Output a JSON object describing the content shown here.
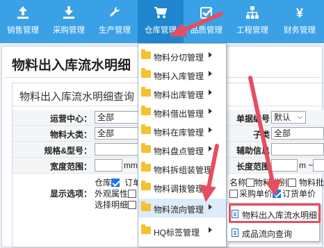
{
  "nav": [
    {
      "label": "销售管理",
      "icon": "upload-icon"
    },
    {
      "label": "采购管理",
      "icon": "download-icon"
    },
    {
      "label": "生产管理",
      "icon": "wrench-icon"
    },
    {
      "label": "仓库管理",
      "icon": "cart-icon"
    },
    {
      "label": "品质管理",
      "icon": "check-icon"
    },
    {
      "label": "工程管理",
      "icon": "sitemap-icon"
    },
    {
      "label": "财务管理",
      "icon": "yen-icon"
    }
  ],
  "page": {
    "title": "物料出入库流水明细"
  },
  "query": {
    "title": "物料出入库流水明细查询",
    "rows": {
      "center_label": "运营中心：",
      "center_value": "全部",
      "category_label": "物料大类：",
      "category_value": "全部",
      "spec_label": "规格&型号：",
      "width_label": "宽度范围：",
      "width_unit": "mm",
      "display_label": "显示选项：",
      "doc_label": "单据编号：",
      "doc_value": "默认",
      "subclass_label": "子类：",
      "subclass_value": "全部",
      "aux_label": "辅助信息：",
      "length_label": "长度范围：",
      "length_unit": "m ~"
    },
    "options": {
      "warehouse": "仓库",
      "order": "订单",
      "appearance": "外观属性",
      "detail": "选择明细",
      "name": "名称",
      "category": "物料类别",
      "batch": "物料批号",
      "purchase_price": "采购单价",
      "order_price": "订货单价"
    }
  },
  "menu": {
    "items": [
      {
        "label": "物料分切管理",
        "arrow": true
      },
      {
        "label": "物料入库管理",
        "arrow": true
      },
      {
        "label": "物料出库管理",
        "arrow": true
      },
      {
        "label": "物料借出管理",
        "arrow": true
      },
      {
        "label": "物料在库管理",
        "arrow": true
      },
      {
        "label": "物料盘点管理",
        "arrow": true
      },
      {
        "label": "物料拆组装管理",
        "arrow": false
      },
      {
        "label": "物料调拨管理",
        "arrow": false
      },
      {
        "label": "物料流向管理",
        "arrow": true
      },
      {
        "label": "HQ标签管理",
        "arrow": true
      }
    ],
    "submenu": [
      {
        "label": "物料出入库流水明细"
      },
      {
        "label": "成品流向查询"
      }
    ]
  },
  "annotation_color": "#e54e61"
}
